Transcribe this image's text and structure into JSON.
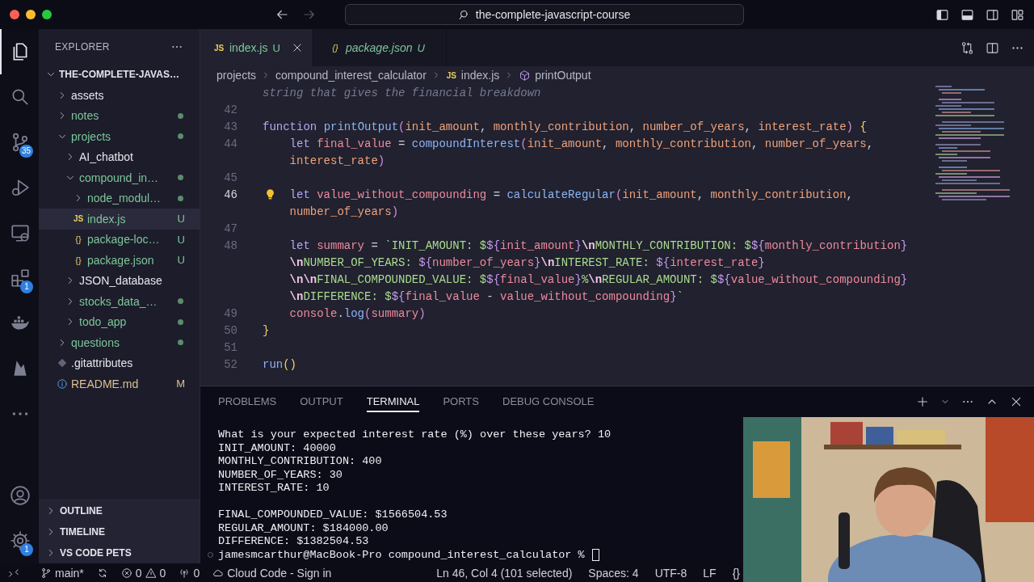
{
  "window": {
    "title": "the-complete-javascript-course"
  },
  "activity_bar": [
    {
      "kind": "explorer",
      "selected": true
    },
    {
      "kind": "search",
      "selected": false
    },
    {
      "kind": "source-control",
      "selected": false,
      "badge": "35"
    },
    {
      "kind": "run-debug",
      "selected": false
    },
    {
      "kind": "remote-explorer",
      "selected": false
    },
    {
      "kind": "extensions",
      "selected": false,
      "badge": "1"
    },
    {
      "kind": "docker",
      "selected": false
    },
    {
      "kind": "firebase",
      "selected": false
    },
    {
      "kind": "more",
      "selected": false
    }
  ],
  "activity_bottom": [
    {
      "kind": "account",
      "selected": false
    },
    {
      "kind": "manage",
      "selected": false,
      "badge": "1"
    }
  ],
  "explorer": {
    "title": "EXPLORER",
    "root": {
      "label": "THE-COMPLETE-JAVAS…",
      "expanded": true
    },
    "tree": [
      {
        "label": "assets",
        "kind": "folder",
        "expanded": false,
        "untracked": false,
        "modified": false,
        "selected": false
      },
      {
        "label": "notes",
        "kind": "folder",
        "expanded": false,
        "untracked": true,
        "modified": false,
        "selected": false
      },
      {
        "label": "projects",
        "kind": "folder",
        "expanded": true,
        "untracked": true,
        "modified": false,
        "selected": false,
        "children": [
          {
            "label": "AI_chatbot",
            "kind": "folder",
            "expanded": false,
            "untracked": false,
            "modified": false,
            "selected": false
          },
          {
            "label": "compound_in…",
            "kind": "folder",
            "expanded": true,
            "untracked": true,
            "modified": false,
            "selected": false,
            "children": [
              {
                "label": "node_modul…",
                "kind": "folder",
                "expanded": false,
                "untracked": true,
                "modified": false,
                "selected": false
              },
              {
                "label": "index.js",
                "kind": "js",
                "icon_text": "JS",
                "untracked": true,
                "modified": false,
                "decoration": "U",
                "selected": true
              },
              {
                "label": "package-loc…",
                "kind": "json",
                "icon_text": "{}",
                "untracked": true,
                "modified": false,
                "decoration": "U",
                "selected": false
              },
              {
                "label": "package.json",
                "kind": "json",
                "icon_text": "{}",
                "untracked": true,
                "modified": false,
                "decoration": "U",
                "selected": false
              }
            ]
          },
          {
            "label": "JSON_database",
            "kind": "folder",
            "expanded": false,
            "untracked": false,
            "modified": false,
            "selected": false
          },
          {
            "label": "stocks_data_…",
            "kind": "folder",
            "expanded": false,
            "untracked": true,
            "modified": false,
            "selected": false
          },
          {
            "label": "todo_app",
            "kind": "folder",
            "expanded": false,
            "untracked": true,
            "modified": false,
            "selected": false
          }
        ]
      },
      {
        "label": "questions",
        "kind": "folder",
        "expanded": false,
        "untracked": true,
        "modified": false,
        "selected": false
      },
      {
        "label": ".gitattributes",
        "kind": "git",
        "untracked": false,
        "modified": false,
        "selected": false
      },
      {
        "label": "README.md",
        "kind": "info",
        "modified": true,
        "decoration": "M",
        "selected": false
      }
    ],
    "sections": [
      {
        "label": "OUTLINE",
        "expanded": false
      },
      {
        "label": "TIMELINE",
        "expanded": false
      },
      {
        "label": "VS CODE PETS",
        "expanded": false
      }
    ]
  },
  "editor_tabs": [
    {
      "label": "index.js",
      "kind": "js",
      "icon_text": "JS",
      "decoration": "U",
      "selected": true,
      "preview": false
    },
    {
      "label": "package.json",
      "kind": "json",
      "icon_text": "{}",
      "decoration": "U",
      "selected": false,
      "preview": true
    }
  ],
  "breadcrumbs": [
    {
      "label": "projects"
    },
    {
      "label": "compound_interest_calculator"
    },
    {
      "label": "index.js",
      "kind": "js",
      "icon_text": "JS"
    },
    {
      "label": "printOutput",
      "kind": "symbol"
    }
  ],
  "code": [
    {
      "rows": [
        {
          "indented": false,
          "segments": [
            {
              "text": "string that gives the financial breakdown",
              "kind": "comment"
            }
          ]
        }
      ]
    },
    {
      "number": "42"
    },
    {
      "number": "43",
      "rows": [
        {
          "indented": false,
          "segments": [
            {
              "text": "function ",
              "kind": "keyword"
            },
            {
              "text": "printOutput",
              "kind": "function"
            },
            {
              "text": "(",
              "kind": "bracket2"
            },
            {
              "text": "init_amount",
              "kind": "parameter"
            },
            {
              "text": ", "
            },
            {
              "text": "monthly_contribution",
              "kind": "parameter"
            },
            {
              "text": ", "
            },
            {
              "text": "number_of_years",
              "kind": "parameter"
            },
            {
              "text": ", "
            },
            {
              "text": "interest_rate",
              "kind": "parameter"
            },
            {
              "text": ") ",
              "kind": "bracket2"
            },
            {
              "text": "{",
              "kind": "bracket1"
            }
          ]
        }
      ]
    },
    {
      "number": "44",
      "rows": [
        {
          "indented": true,
          "segments": [
            {
              "text": "let ",
              "kind": "keyword"
            },
            {
              "text": "final_value",
              "kind": "variable"
            },
            {
              "text": " = "
            },
            {
              "text": "compoundInterest",
              "kind": "function"
            },
            {
              "text": "(",
              "kind": "bracket2"
            },
            {
              "text": "init_amount",
              "kind": "parameter"
            },
            {
              "text": ", "
            },
            {
              "text": "monthly_contribution",
              "kind": "parameter"
            },
            {
              "text": ", "
            },
            {
              "text": "number_of_years",
              "kind": "parameter"
            },
            {
              "text": ","
            }
          ]
        },
        {
          "indented": true,
          "segments": [
            {
              "text": "interest_rate",
              "kind": "parameter"
            },
            {
              "text": ")",
              "kind": "bracket2"
            }
          ]
        }
      ]
    },
    {
      "number": "45"
    },
    {
      "number": "46",
      "active": true,
      "lightbulb": true,
      "rows": [
        {
          "indented": true,
          "segments": [
            {
              "text": "let ",
              "kind": "keyword"
            },
            {
              "text": "value_without_compounding",
              "kind": "variable"
            },
            {
              "text": " = "
            },
            {
              "text": "calculateRegular",
              "kind": "function"
            },
            {
              "text": "(",
              "kind": "bracket2"
            },
            {
              "text": "init_amount",
              "kind": "parameter"
            },
            {
              "text": ", "
            },
            {
              "text": "monthly_contribution",
              "kind": "parameter"
            },
            {
              "text": ","
            }
          ]
        },
        {
          "indented": true,
          "segments": [
            {
              "text": "number_of_years",
              "kind": "parameter"
            },
            {
              "text": ")",
              "kind": "bracket2"
            }
          ]
        }
      ]
    },
    {
      "number": "47"
    },
    {
      "number": "48",
      "rows": [
        {
          "indented": true,
          "segments": [
            {
              "text": "let ",
              "kind": "keyword"
            },
            {
              "text": "summary",
              "kind": "variable"
            },
            {
              "text": " = "
            },
            {
              "text": "`INIT_AMOUNT: $",
              "kind": "string"
            },
            {
              "text": "${",
              "kind": "interpolation"
            },
            {
              "text": "init_amount",
              "kind": "variable"
            },
            {
              "text": "}",
              "kind": "interpolation"
            },
            {
              "text": "\\n",
              "kind": "escape"
            },
            {
              "text": "MONTHLY_CONTRIBUTION: $",
              "kind": "string"
            },
            {
              "text": "${",
              "kind": "interpolation"
            },
            {
              "text": "monthly_contribution",
              "kind": "variable"
            },
            {
              "text": "}",
              "kind": "interpolation"
            }
          ]
        },
        {
          "indented": true,
          "segments": [
            {
              "text": "\\n",
              "kind": "escape"
            },
            {
              "text": "NUMBER_OF_YEARS: ",
              "kind": "string"
            },
            {
              "text": "${",
              "kind": "interpolation"
            },
            {
              "text": "number_of_years",
              "kind": "variable"
            },
            {
              "text": "}",
              "kind": "interpolation"
            },
            {
              "text": "\\n",
              "kind": "escape"
            },
            {
              "text": "INTEREST_RATE: ",
              "kind": "string"
            },
            {
              "text": "${",
              "kind": "interpolation"
            },
            {
              "text": "interest_rate",
              "kind": "variable"
            },
            {
              "text": "}",
              "kind": "interpolation"
            }
          ]
        },
        {
          "indented": true,
          "segments": [
            {
              "text": "\\n\\n",
              "kind": "escape"
            },
            {
              "text": "FINAL_COMPOUNDED_VALUE: $",
              "kind": "string"
            },
            {
              "text": "${",
              "kind": "interpolation"
            },
            {
              "text": "final_value",
              "kind": "variable"
            },
            {
              "text": "}",
              "kind": "interpolation"
            },
            {
              "text": "%",
              "kind": "string"
            },
            {
              "text": "\\n",
              "kind": "escape"
            },
            {
              "text": "REGULAR_AMOUNT: $",
              "kind": "string"
            },
            {
              "text": "${",
              "kind": "interpolation"
            },
            {
              "text": "value_without_compounding",
              "kind": "variable"
            },
            {
              "text": "}",
              "kind": "interpolation"
            }
          ]
        },
        {
          "indented": true,
          "segments": [
            {
              "text": "\\n",
              "kind": "escape"
            },
            {
              "text": "DIFFERENCE: $",
              "kind": "string"
            },
            {
              "text": "${",
              "kind": "interpolation"
            },
            {
              "text": "final_value",
              "kind": "variable"
            },
            {
              "text": " - "
            },
            {
              "text": "value_without_compounding",
              "kind": "variable"
            },
            {
              "text": "}",
              "kind": "interpolation"
            },
            {
              "text": "`",
              "kind": "string"
            }
          ]
        }
      ]
    },
    {
      "number": "49",
      "rows": [
        {
          "indented": true,
          "segments": [
            {
              "text": "console",
              "kind": "variable"
            },
            {
              "text": "."
            },
            {
              "text": "log",
              "kind": "function"
            },
            {
              "text": "(",
              "kind": "bracket2"
            },
            {
              "text": "summary",
              "kind": "variable"
            },
            {
              "text": ")",
              "kind": "bracket2"
            }
          ]
        }
      ]
    },
    {
      "number": "50",
      "rows": [
        {
          "indented": false,
          "segments": [
            {
              "text": "}",
              "kind": "bracket1"
            }
          ]
        }
      ]
    },
    {
      "number": "51"
    },
    {
      "number": "52",
      "rows": [
        {
          "indented": false,
          "segments": [
            {
              "text": "run",
              "kind": "function"
            },
            {
              "text": "()",
              "kind": "bracket1"
            }
          ]
        }
      ]
    }
  ],
  "panel": {
    "tabs": [
      {
        "label": "PROBLEMS",
        "selected": false
      },
      {
        "label": "OUTPUT",
        "selected": false
      },
      {
        "label": "TERMINAL",
        "selected": true
      },
      {
        "label": "PORTS",
        "selected": false
      },
      {
        "label": "DEBUG CONSOLE",
        "selected": false
      }
    ],
    "terminal": {
      "blocks": [
        [
          "What is your expected interest rate (%) over these years? 10",
          "INIT_AMOUNT: 40000",
          "MONTHLY_CONTRIBUTION: 400",
          "NUMBER_OF_YEARS: 30",
          "INTEREST_RATE: 10"
        ],
        [
          "FINAL_COMPOUNDED_VALUE: $1566504.53",
          "REGULAR_AMOUNT: $184000.00",
          "DIFFERENCE: $1382504.53"
        ]
      ],
      "prompt": "jamesmcarthur@MacBook-Pro compound_interest_calculator %"
    }
  },
  "status_bar": {
    "left": [
      {
        "kind": "remote"
      },
      {
        "kind": "branch",
        "text": "main*"
      },
      {
        "kind": "sync"
      },
      {
        "kind": "problems",
        "errors": "0",
        "warnings": "0"
      },
      {
        "kind": "ports",
        "text": "0"
      },
      {
        "kind": "cloud",
        "text": "Cloud Code - Sign in"
      }
    ],
    "right": [
      "Ln 46, Col 4 (101 selected)",
      "Spaces: 4",
      "UTF-8",
      "LF",
      "{}"
    ]
  }
}
